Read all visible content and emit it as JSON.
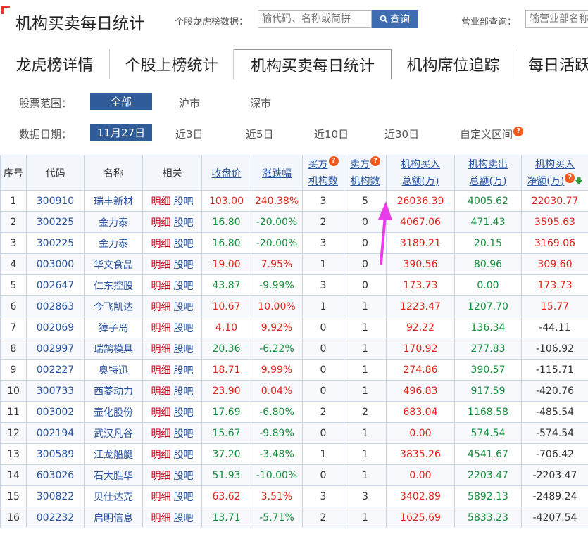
{
  "header": {
    "title": "机构买卖每日统计",
    "search_label": "个股龙虎榜数据：",
    "search_placeholder": "输代码、名称或简拼",
    "search_button": "查询",
    "dept_label": "营业部查询：",
    "dept_placeholder": "输营业部名称"
  },
  "tabs": [
    {
      "label": "龙虎榜详情"
    },
    {
      "label": "个股上榜统计"
    },
    {
      "label": "机构买卖每日统计"
    },
    {
      "label": "机构席位追踪"
    },
    {
      "label": "每日活跃"
    }
  ],
  "filters": {
    "scope_label": "股票范围：",
    "scope_options": [
      "全部",
      "沪市",
      "深市"
    ],
    "date_label": "数据日期：",
    "date_options": [
      "11月27日",
      "近3日",
      "近5日",
      "近10日",
      "近30日",
      "自定义区间"
    ]
  },
  "table": {
    "headers": {
      "idx": "序号",
      "code": "代码",
      "name": "名称",
      "related": "相关",
      "close": "收盘价",
      "change": "涨跌幅",
      "buy_top": "买方",
      "buy_bottom": "机构数",
      "sell_top": "卖方",
      "sell_bottom": "机构数",
      "buyamt_top": "机构买入",
      "buyamt_bottom": "总额(万)",
      "sellamt_top": "机构卖出",
      "sellamt_bottom": "总额(万)",
      "net_top": "机构买入",
      "net_bottom": "净额(万)"
    },
    "detail_label": "明细",
    "guba_label": "股吧",
    "rows": [
      {
        "idx": "1",
        "code": "300910",
        "name": "瑞丰新材",
        "close": "103.00",
        "change": "240.38%",
        "buy": "3",
        "sell": "5",
        "buyamt": "26036.39",
        "sellamt": "4005.62",
        "net": "22030.77",
        "dir": "up"
      },
      {
        "idx": "2",
        "code": "300225",
        "name": "金力泰",
        "close": "16.80",
        "change": "-20.00%",
        "buy": "2",
        "sell": "0",
        "buyamt": "4067.06",
        "sellamt": "471.43",
        "net": "3595.63",
        "dir": "down"
      },
      {
        "idx": "3",
        "code": "300225",
        "name": "金力泰",
        "close": "16.80",
        "change": "-20.00%",
        "buy": "3",
        "sell": "0",
        "buyamt": "3189.21",
        "sellamt": "20.15",
        "net": "3169.06",
        "dir": "down"
      },
      {
        "idx": "4",
        "code": "003000",
        "name": "华文食品",
        "close": "19.00",
        "change": "7.95%",
        "buy": "1",
        "sell": "0",
        "buyamt": "390.56",
        "sellamt": "80.96",
        "net": "309.60",
        "dir": "up"
      },
      {
        "idx": "5",
        "code": "002647",
        "name": "仁东控股",
        "close": "43.87",
        "change": "-9.99%",
        "buy": "3",
        "sell": "0",
        "buyamt": "173.73",
        "sellamt": "0.00",
        "net": "173.73",
        "dir": "down"
      },
      {
        "idx": "6",
        "code": "002863",
        "name": "今飞凯达",
        "close": "10.67",
        "change": "10.00%",
        "buy": "1",
        "sell": "1",
        "buyamt": "1223.47",
        "sellamt": "1207.70",
        "net": "15.77",
        "dir": "up"
      },
      {
        "idx": "7",
        "code": "002069",
        "name": "獐子岛",
        "close": "4.10",
        "change": "9.92%",
        "buy": "0",
        "sell": "1",
        "buyamt": "92.22",
        "sellamt": "136.34",
        "net": "-44.11",
        "dir": "up"
      },
      {
        "idx": "8",
        "code": "002997",
        "name": "瑞鹄模具",
        "close": "20.36",
        "change": "-6.22%",
        "buy": "0",
        "sell": "1",
        "buyamt": "170.92",
        "sellamt": "277.83",
        "net": "-106.92",
        "dir": "down"
      },
      {
        "idx": "9",
        "code": "002227",
        "name": "奥特迅",
        "close": "18.71",
        "change": "9.99%",
        "buy": "0",
        "sell": "1",
        "buyamt": "274.86",
        "sellamt": "390.57",
        "net": "-115.71",
        "dir": "up"
      },
      {
        "idx": "10",
        "code": "300733",
        "name": "西菱动力",
        "close": "23.90",
        "change": "0.04%",
        "buy": "0",
        "sell": "1",
        "buyamt": "496.83",
        "sellamt": "917.59",
        "net": "-420.76",
        "dir": "up"
      },
      {
        "idx": "11",
        "code": "003002",
        "name": "壶化股份",
        "close": "17.69",
        "change": "-6.80%",
        "buy": "2",
        "sell": "2",
        "buyamt": "683.04",
        "sellamt": "1168.58",
        "net": "-485.54",
        "dir": "down"
      },
      {
        "idx": "12",
        "code": "002194",
        "name": "武汉凡谷",
        "close": "15.67",
        "change": "-9.89%",
        "buy": "0",
        "sell": "1",
        "buyamt": "0.00",
        "sellamt": "574.54",
        "net": "-574.54",
        "dir": "down"
      },
      {
        "idx": "13",
        "code": "300589",
        "name": "江龙船艇",
        "close": "37.20",
        "change": "-3.48%",
        "buy": "1",
        "sell": "1",
        "buyamt": "3835.26",
        "sellamt": "4541.67",
        "net": "-706.42",
        "dir": "down"
      },
      {
        "idx": "14",
        "code": "603026",
        "name": "石大胜华",
        "close": "51.93",
        "change": "-10.00%",
        "buy": "0",
        "sell": "1",
        "buyamt": "0.00",
        "sellamt": "2203.47",
        "net": "-2203.47",
        "dir": "down"
      },
      {
        "idx": "15",
        "code": "300822",
        "name": "贝仕达克",
        "close": "63.62",
        "change": "3.51%",
        "buy": "3",
        "sell": "3",
        "buyamt": "3402.89",
        "sellamt": "5892.13",
        "net": "-2489.24",
        "dir": "up"
      },
      {
        "idx": "16",
        "code": "002232",
        "name": "启明信息",
        "close": "13.71",
        "change": "-5.71%",
        "buy": "2",
        "sell": "1",
        "buyamt": "1625.69",
        "sellamt": "5833.23",
        "net": "-4207.54",
        "dir": "down"
      }
    ]
  },
  "colors": {
    "accent": "#305c99",
    "up": "#e2231a",
    "down": "#14903a",
    "help": "#f25a1c",
    "annotation": "#e83ce8"
  }
}
